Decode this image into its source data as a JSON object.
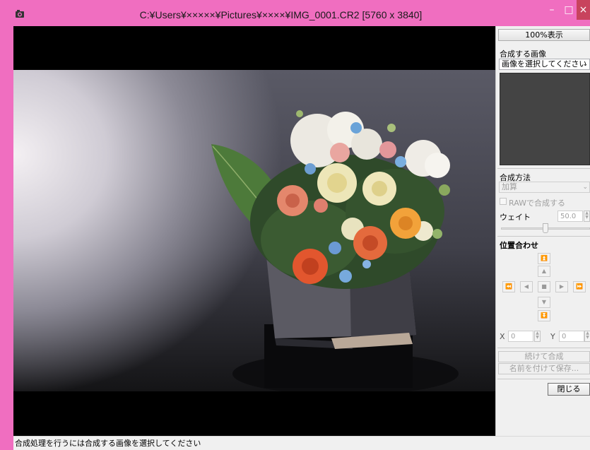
{
  "window": {
    "title": "C:¥Users¥×××××¥Pictures¥××××¥IMG_0001.CR2 [5760 x 3840]",
    "controls": {
      "minimize": "–",
      "maximize": "□",
      "close": "×"
    }
  },
  "panel": {
    "zoom_button": "100%表示",
    "composite_image_label": "合成する画像",
    "composite_image_select": "画像を選択してください",
    "method_label": "合成方法",
    "method_select": "加算",
    "raw_checkbox_label": "RAWで合成する",
    "weight_label": "ウェイト",
    "weight_value": "50.0",
    "weight_slider_fraction": 0.5,
    "align_label": "位置合わせ",
    "align_buttons": {
      "up_far": "⏫",
      "up": "▲",
      "left_far": "⏪",
      "left": "◀",
      "center": "■",
      "right": "▶",
      "right_far": "⏩",
      "down": "▼",
      "down_far": "⏬"
    },
    "x_label": "X",
    "x_value": "0",
    "y_label": "Y",
    "y_value": "0",
    "continue_button": "続けて合成",
    "save_as_button": "名前を付けて保存...",
    "close_button": "閉じる"
  },
  "status": {
    "message": "合成処理を行うには合成する画像を選択してください"
  },
  "icons": {
    "app": "app-icon",
    "chevron": "chevron-down-icon"
  },
  "colors": {
    "frame": "#f06ec0",
    "close_button": "#c8435d"
  }
}
